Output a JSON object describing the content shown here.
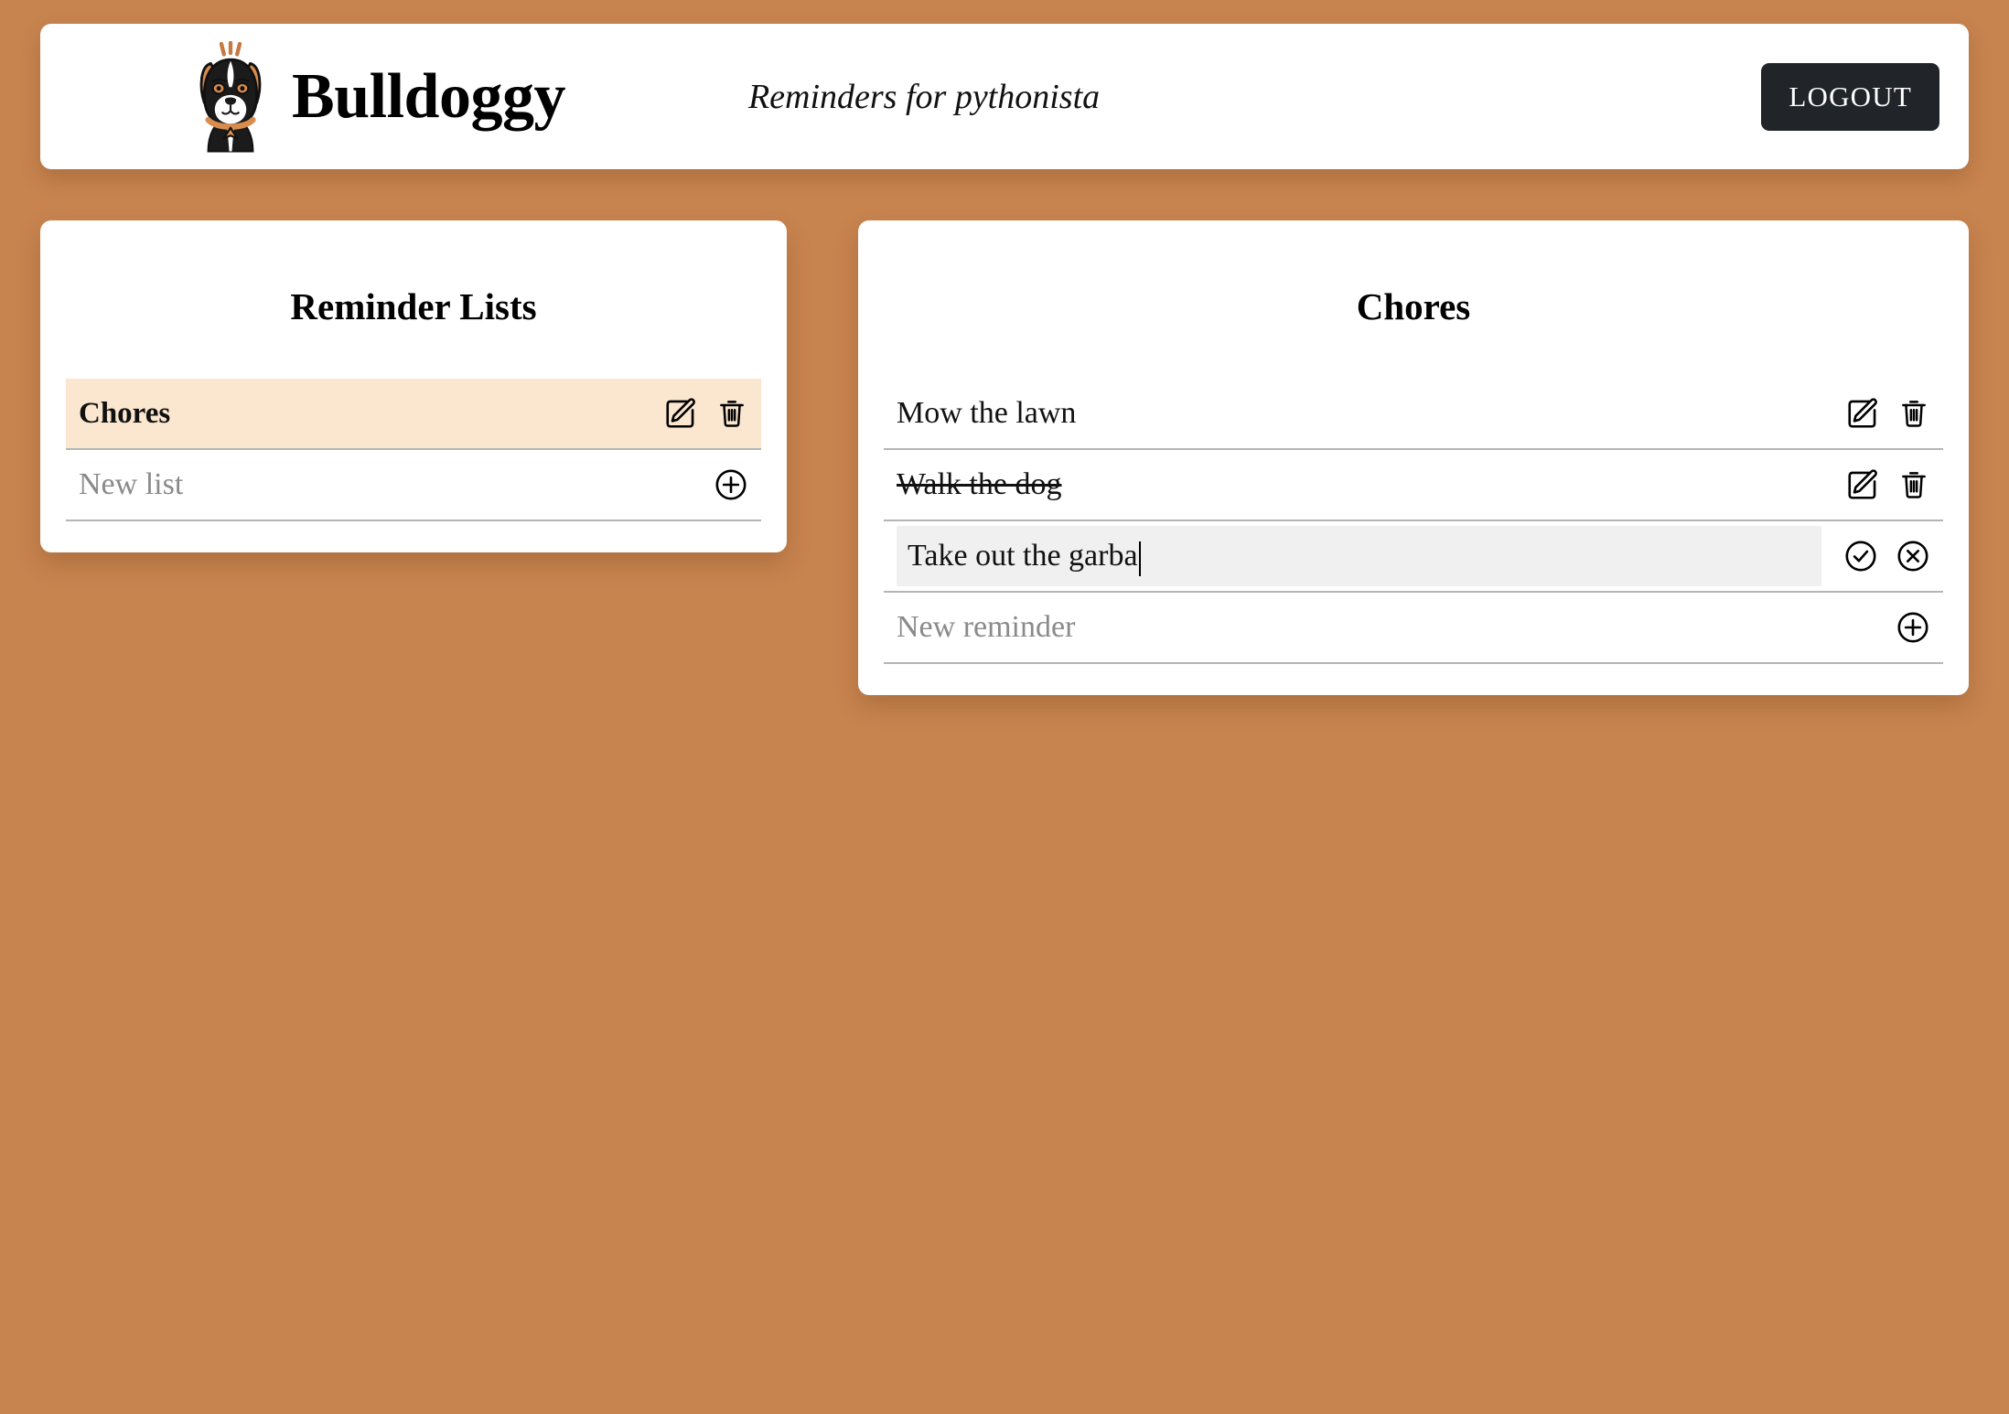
{
  "theme": {
    "background": "#c8844f",
    "card_background": "#ffffff",
    "selected_row_background": "#fbe7cf",
    "edit_field_background": "#f0f0f0",
    "button_background": "#212529",
    "divider": "#b5b5b5",
    "placeholder_text": "#8a8a8a"
  },
  "header": {
    "logo_icon": "bulldog-logo-icon",
    "title": "Bulldoggy",
    "tagline": "Reminders for pythonista",
    "logout_label": "LOGOUT"
  },
  "lists_panel": {
    "title": "Reminder Lists",
    "rows": [
      {
        "label": "Chores",
        "selected": true,
        "actions": [
          "edit-icon",
          "delete-icon"
        ]
      }
    ],
    "new_row": {
      "placeholder": "New list",
      "action": "add-icon"
    }
  },
  "items_panel": {
    "title": "Chores",
    "rows": [
      {
        "label": "Mow the lawn",
        "completed": false,
        "editing": false,
        "actions": [
          "edit-icon",
          "delete-icon"
        ]
      },
      {
        "label": "Walk the dog",
        "completed": true,
        "editing": false,
        "actions": [
          "edit-icon",
          "delete-icon"
        ]
      },
      {
        "label": "Take out the garba",
        "completed": false,
        "editing": true,
        "actions": [
          "confirm-icon",
          "cancel-icon"
        ]
      }
    ],
    "new_row": {
      "placeholder": "New reminder",
      "action": "add-icon"
    }
  }
}
